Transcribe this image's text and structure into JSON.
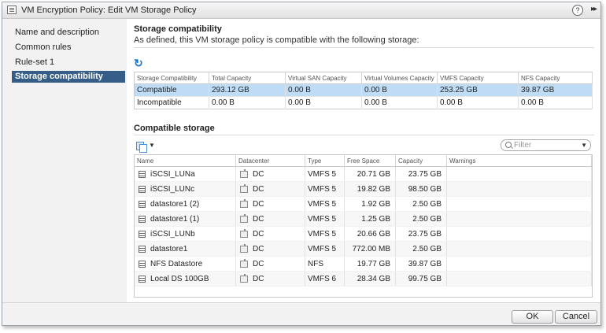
{
  "dialog": {
    "title": "VM Encryption Policy: Edit VM Storage Policy",
    "help_label": "?",
    "expand_label": "▸▸"
  },
  "sidebar": {
    "items": [
      {
        "label": "Name and description"
      },
      {
        "label": "Common rules"
      },
      {
        "label": "Rule-set 1"
      },
      {
        "label": "Storage compatibility",
        "selected": true
      }
    ]
  },
  "main": {
    "section_title": "Storage compatibility",
    "section_desc": "As defined, this VM storage policy is compatible with the following storage:",
    "refresh_icon": "refresh-icon",
    "summary_table": {
      "headers": [
        "Storage Compatibility",
        "Total Capacity",
        "Virtual SAN Capacity",
        "Virtual Volumes Capacity",
        "VMFS Capacity",
        "NFS Capacity"
      ],
      "rows": [
        [
          "Compatible",
          "293.12 GB",
          "0.00 B",
          "0.00 B",
          "253.25 GB",
          "39.87 GB"
        ],
        [
          "Incompatible",
          "0.00 B",
          "0.00 B",
          "0.00 B",
          "0.00 B",
          "0.00 B"
        ]
      ]
    },
    "compatible_title": "Compatible storage",
    "filter_placeholder": "Filter",
    "storage_table": {
      "headers": [
        "Name",
        "Datacenter",
        "Type",
        "Free Space",
        "Capacity",
        "Warnings"
      ],
      "rows": [
        [
          "iSCSI_LUNa",
          "DC",
          "VMFS 5",
          "20.71 GB",
          "23.75 GB",
          ""
        ],
        [
          "iSCSI_LUNc",
          "DC",
          "VMFS 5",
          "19.82 GB",
          "98.50 GB",
          ""
        ],
        [
          "datastore1 (2)",
          "DC",
          "VMFS 5",
          "1.92 GB",
          "2.50 GB",
          ""
        ],
        [
          "datastore1 (1)",
          "DC",
          "VMFS 5",
          "1.25 GB",
          "2.50 GB",
          ""
        ],
        [
          "iSCSI_LUNb",
          "DC",
          "VMFS 5",
          "20.66 GB",
          "23.75 GB",
          ""
        ],
        [
          "datastore1",
          "DC",
          "VMFS 5",
          "772.00 MB",
          "2.50 GB",
          ""
        ],
        [
          "NFS Datastore",
          "DC",
          "NFS",
          "19.77 GB",
          "39.87 GB",
          ""
        ],
        [
          "Local DS 100GB",
          "DC",
          "VMFS 6",
          "28.34 GB",
          "99.75 GB",
          ""
        ]
      ]
    }
  },
  "footer": {
    "ok_label": "OK",
    "cancel_label": "Cancel"
  },
  "colors": {
    "selected_nav": "#355d87",
    "selected_row": "#bfdcf6",
    "refresh": "#1877c9"
  }
}
